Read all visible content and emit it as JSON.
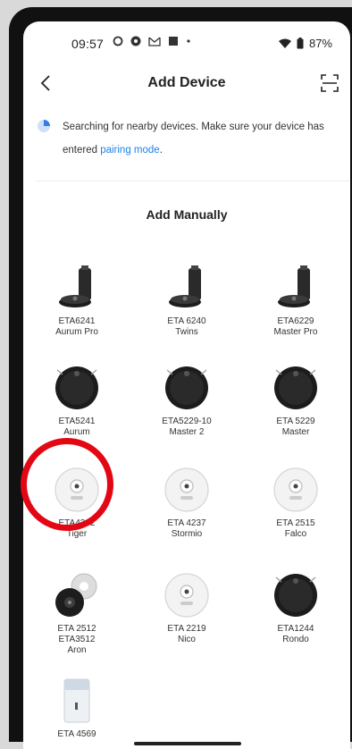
{
  "status_bar": {
    "time": "09:57",
    "battery": "87%"
  },
  "header": {
    "title": "Add Device"
  },
  "searching": {
    "text": "Searching for nearby devices. Make sure your device has entered ",
    "link": "pairing mode",
    "suffix": "."
  },
  "section_title": "Add Manually",
  "devices": [
    {
      "line1": "ETA6241",
      "line2": "Aurum Pro",
      "line3": "",
      "icon": "robot-vacuum-dock-icon"
    },
    {
      "line1": "ETA 6240",
      "line2": "Twins",
      "line3": "",
      "icon": "robot-vacuum-dock-icon"
    },
    {
      "line1": "ETA6229",
      "line2": "Master Pro",
      "line3": "",
      "icon": "robot-vacuum-dock-icon"
    },
    {
      "line1": "ETA5241",
      "line2": "Aurum",
      "line3": "",
      "icon": "robot-vacuum-black-icon"
    },
    {
      "line1": "ETA5229-10",
      "line2": "Master 2",
      "line3": "",
      "icon": "robot-vacuum-black-icon"
    },
    {
      "line1": "ETA 5229",
      "line2": "Master",
      "line3": "",
      "icon": "robot-vacuum-black-icon"
    },
    {
      "line1": "ETA4242",
      "line2": "Tiger",
      "line3": "",
      "icon": "robot-vacuum-white-icon"
    },
    {
      "line1": "ETA 4237",
      "line2": "Stormio",
      "line3": "",
      "icon": "robot-vacuum-white-icon"
    },
    {
      "line1": "ETA 2515",
      "line2": "Falco",
      "line3": "",
      "icon": "robot-vacuum-white-icon"
    },
    {
      "line1": "ETA 2512",
      "line2": "ETA3512",
      "line3": "Aron",
      "icon": "robot-vacuum-pair-icon"
    },
    {
      "line1": "ETA 2219",
      "line2": "Nico",
      "line3": "",
      "icon": "robot-vacuum-white-icon"
    },
    {
      "line1": "ETA1244",
      "line2": "Rondo",
      "line3": "",
      "icon": "robot-vacuum-black-icon"
    },
    {
      "line1": "ETA 4569",
      "line2": "",
      "line3": "",
      "icon": "air-purifier-icon"
    }
  ]
}
